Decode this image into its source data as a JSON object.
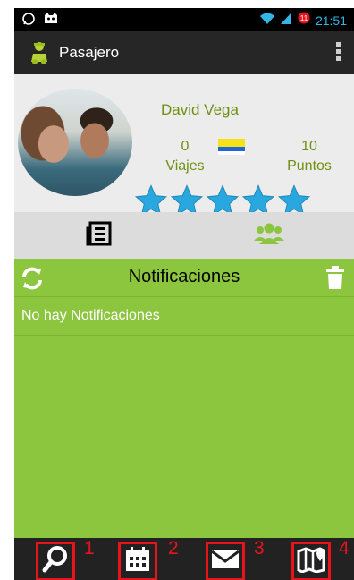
{
  "status_bar": {
    "time": "21:51",
    "icons": [
      "whatsapp-icon",
      "cat-icon",
      "wifi-icon",
      "signal-icon",
      "alarm-icon"
    ]
  },
  "action_bar": {
    "title": "Pasajero",
    "icon": "taxi-driver-icon",
    "overflow_icon": "overflow-menu-icon"
  },
  "profile": {
    "name": "David Vega",
    "trips": {
      "value": "0",
      "label": "Viajes"
    },
    "points": {
      "value": "10",
      "label": "Puntos"
    },
    "rating_stars": 5,
    "flag_colors": [
      "#f5e11a",
      "#2166d6",
      "#ffffff"
    ]
  },
  "tabs": [
    {
      "icon": "newspaper-icon"
    },
    {
      "icon": "people-icon",
      "active": true
    }
  ],
  "notifications": {
    "heading": "Notificaciones",
    "empty_text": "No hay Notificaciones"
  },
  "bottom_nav": [
    {
      "icon": "search-icon",
      "marker": "1"
    },
    {
      "icon": "calendar-icon",
      "marker": "2"
    },
    {
      "icon": "mail-icon",
      "marker": "3"
    },
    {
      "icon": "map-icon",
      "marker": "4"
    }
  ],
  "colors": {
    "accent_green": "#8cc63f",
    "name_green": "#6f8f0f",
    "star_blue": "#29a8e0",
    "marker_red": "#e8141c"
  }
}
